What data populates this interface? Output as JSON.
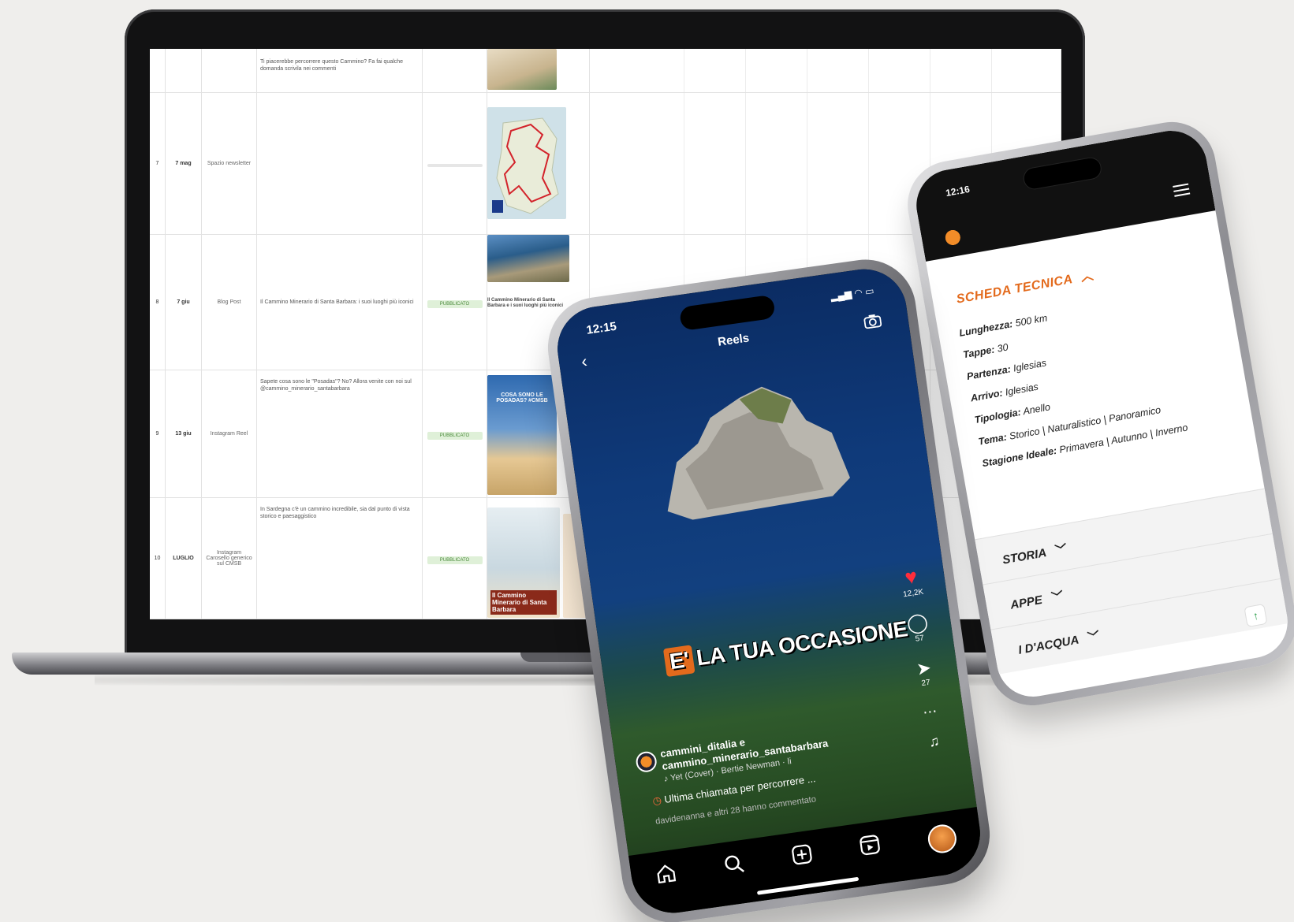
{
  "sheet": {
    "rows": [
      {
        "index": "",
        "date": "",
        "channel": "",
        "text": "Ti piacerebbe percorrere questo Cammino? Fa fai qualche domanda scrivila nei commenti",
        "status": "",
        "image_caption": ""
      },
      {
        "index": "7",
        "date": "7 mag",
        "channel": "Spazio newsletter",
        "text": "",
        "status": "",
        "image_caption": ""
      },
      {
        "index": "8",
        "date": "7 giu",
        "channel": "Blog Post",
        "text": "Il Cammino Minerario di Santa Barbara: i suoi luoghi più iconici",
        "status": "PUBBLICATO",
        "image_caption": "Il Cammino Minerario di Santa Barbara e i suoi luoghi più iconici"
      },
      {
        "index": "9",
        "date": "13 giu",
        "channel": "Instagram Reel",
        "text": "Sapete cosa sono le \"Posadas\"? No? Allora venite con noi sul @cammino_minerario_santabarbara",
        "status": "PUBBLICATO",
        "image_caption": "COSA SONO LE POSADAS? #CMSB"
      },
      {
        "index": "10",
        "date": "LUGLIO",
        "channel": "Instagram Carosello generico sul CMSB",
        "text": "In Sardegna c'è un cammino incredibile, sia dal punto di vista storico e paesaggistico",
        "status": "PUBBLICATO",
        "image_caption": "Il Cammino Minerario di Santa Barbara"
      }
    ]
  },
  "reel": {
    "time": "12:15",
    "title": "Reels",
    "banner_e": "E'",
    "banner_text": "LA TUA OCCASIONE",
    "likes": "12,2K",
    "comments": "57",
    "shares": "27",
    "user_line1": "cammini_ditalia e",
    "user_line2": "cammino_minerario_santabarbara",
    "music": "Yet (Cover) · Bertie Newman · li",
    "caption": "Ultima chiamata per percorrere ...",
    "comment_summary": "davidenanna e altri 28 hanno commentato"
  },
  "site": {
    "time": "12:16",
    "section_title": "SCHEDA TECNICA",
    "specs": [
      {
        "label": "Lunghezza:",
        "value": "500 km"
      },
      {
        "label": "Tappe:",
        "value": "30"
      },
      {
        "label": "Partenza:",
        "value": "Iglesias"
      },
      {
        "label": "Arrivo:",
        "value": "Iglesias"
      },
      {
        "label": "Tipologia:",
        "value": "Anello"
      },
      {
        "label": "Tema:",
        "value": "Storico | Naturalistico | Panoramico"
      },
      {
        "label": "Stagione Ideale:",
        "value": "Primavera | Autunno | Inverno"
      }
    ],
    "accordions": [
      "STORIA",
      "APPE",
      "I D'ACQUA"
    ]
  },
  "colors": {
    "accent": "#e36a1c",
    "published": "#4a8a3a"
  }
}
